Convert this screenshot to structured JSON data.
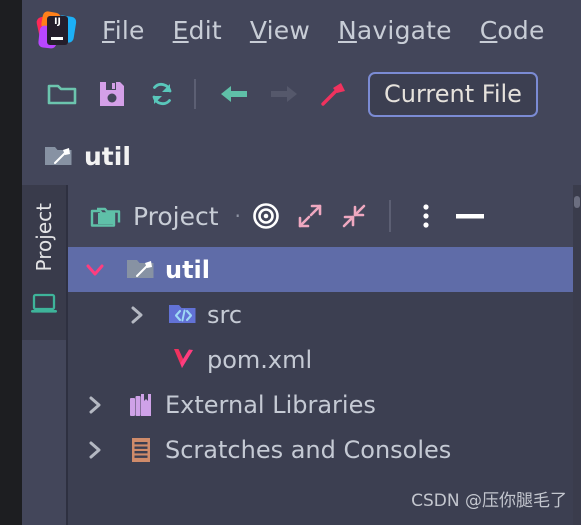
{
  "app": {
    "logo_text": "IJ",
    "background": "#43465a",
    "panel_background": "#3c3f51",
    "selection_color": "#5f6ca8",
    "accent_pink": "#ff3d7f",
    "accent_teal": "#6cc5ae"
  },
  "menubar": {
    "items": [
      {
        "label": "File",
        "mnemonic": "F",
        "rest": "ile"
      },
      {
        "label": "Edit",
        "mnemonic": "E",
        "rest": "dit"
      },
      {
        "label": "View",
        "mnemonic": "V",
        "rest": "iew"
      },
      {
        "label": "Navigate",
        "mnemonic": "N",
        "rest": "avigate"
      },
      {
        "label": "Code",
        "mnemonic": "C",
        "rest": "ode"
      }
    ]
  },
  "toolbar": {
    "buttons": [
      {
        "name": "open-folder-icon",
        "title": "Open",
        "color": "#6cc5ae"
      },
      {
        "name": "save-all-icon",
        "title": "Save All",
        "color": "#d4a0e8"
      },
      {
        "name": "sync-refresh-icon",
        "title": "Reload All from Disk",
        "color": "#59c7bb"
      },
      {
        "name": "back-arrow-icon",
        "title": "Back",
        "color": "#5fc0a8"
      },
      {
        "name": "forward-arrow-icon",
        "title": "Forward",
        "color": "#55586b"
      },
      {
        "name": "build-hammer-icon",
        "title": "Build Project",
        "color": "#f0325e"
      }
    ],
    "run_config": "Current File"
  },
  "navbar": {
    "crumb_label": "util",
    "crumb_icon": "module-folder-icon"
  },
  "stripe": {
    "tab_label": "Project",
    "bottom_icon": "remote-laptop-icon"
  },
  "toolwindow": {
    "title": "Project",
    "title_icon": "project-folder-icon",
    "dot": "·",
    "actions": [
      {
        "name": "scroll-from-source-icon",
        "title": "Select Opened File"
      },
      {
        "name": "expand-all-icon",
        "title": "Expand All"
      },
      {
        "name": "collapse-all-icon",
        "title": "Collapse All"
      },
      {
        "name": "more-options-icon",
        "title": "Options"
      },
      {
        "name": "hide-panel-icon",
        "title": "Hide"
      }
    ]
  },
  "tree": {
    "rows": [
      {
        "label": "util",
        "icon": "module-folder-icon",
        "arrow": "chevron-down",
        "indent": 0,
        "selected": true
      },
      {
        "label": "src",
        "icon": "source-folder-icon",
        "arrow": "chevron-right",
        "indent": 1,
        "selected": false
      },
      {
        "label": "pom.xml",
        "icon": "maven-pom-icon",
        "arrow": "none",
        "indent": 1,
        "selected": false
      },
      {
        "label": "External Libraries",
        "icon": "libraries-icon",
        "arrow": "chevron-right",
        "indent": 0,
        "selected": false
      },
      {
        "label": "Scratches and Consoles",
        "icon": "scratches-icon",
        "arrow": "chevron-right",
        "indent": 0,
        "selected": false
      }
    ]
  },
  "watermark": {
    "text": "CSDN @压你腿毛了"
  }
}
